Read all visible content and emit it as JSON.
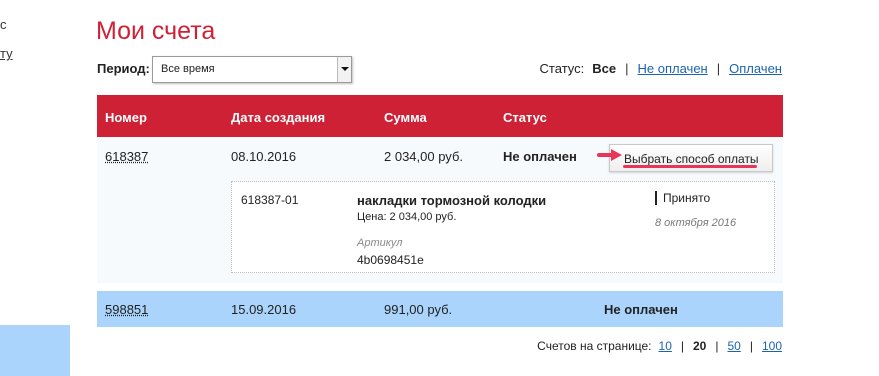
{
  "left_fragments": {
    "line1": "c",
    "line2": "ту"
  },
  "page": {
    "title": "Мои счета"
  },
  "period": {
    "label": "Период:",
    "value": "Все время"
  },
  "status_filter": {
    "label": "Статус:",
    "all": "Все",
    "unpaid": "Не оплачен",
    "paid": "Оплачен"
  },
  "table": {
    "headers": {
      "number": "Номер",
      "created": "Дата создания",
      "sum": "Сумма",
      "status": "Статус"
    },
    "rows": [
      {
        "number": "618387",
        "created": "08.10.2016",
        "sum": "2 034,00 руб.",
        "status": "Не оплачен",
        "action_label": "Выбрать способ оплаты",
        "detail": {
          "item_id": "618387-01",
          "item_name": "накладки тормозной колодки",
          "price": "Цена: 2 034,00 руб.",
          "article_label": "Артикул",
          "article_value": "4b0698451e",
          "state": "Принято",
          "state_date": "8 октября 2016"
        }
      },
      {
        "number": "598851",
        "created": "15.09.2016",
        "sum": "991,00 руб.",
        "status": "Не оплачен"
      }
    ]
  },
  "pagination": {
    "label": "Счетов на странице:",
    "options": [
      "10",
      "20",
      "50",
      "100"
    ],
    "current": "20"
  },
  "colors": {
    "accent": "#cf2136",
    "link": "#1b64b1",
    "highlight_row": "#aad4fb",
    "hint": "#e8365a"
  }
}
